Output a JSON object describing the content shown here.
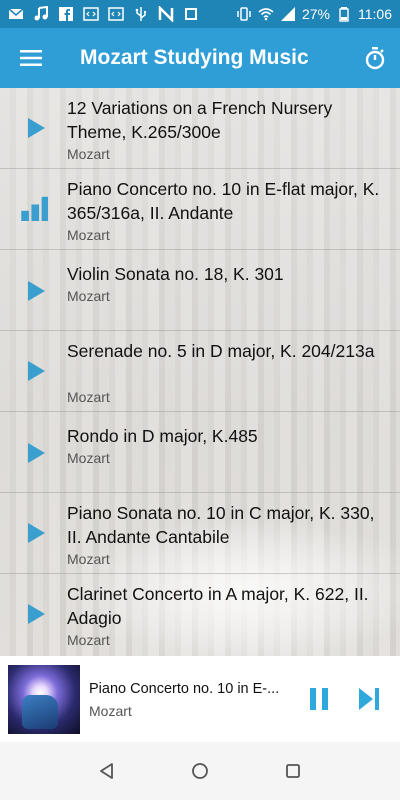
{
  "status_bar": {
    "battery": "27%",
    "time": "11:06",
    "icons": [
      "mail-icon",
      "music-note-icon",
      "facebook-icon",
      "code-icon",
      "code-icon",
      "usb-icon",
      "n-icon",
      "screenshot-icon",
      "vibrate-icon",
      "wifi-icon",
      "signal-icon",
      "battery-icon"
    ]
  },
  "app_bar": {
    "title": "Mozart Studying Music"
  },
  "tracks": [
    {
      "title": "12 Variations on a French Nursery Theme, K.265/300e",
      "artist": "Mozart",
      "state": "play"
    },
    {
      "title": "Piano Concerto no. 10 in E-flat major, K. 365/316a, II. Andante",
      "artist": "Mozart",
      "state": "playing"
    },
    {
      "title": "Violin Sonata no. 18, K. 301",
      "artist": "Mozart",
      "state": "play"
    },
    {
      "title": "Serenade no. 5 in D major, K. 204/213a",
      "artist": "Mozart",
      "state": "play"
    },
    {
      "title": "Rondo in D major, K.485",
      "artist": "Mozart",
      "state": "play"
    },
    {
      "title": "Piano Sonata no. 10 in C major, K. 330, II. Andante Cantabile",
      "artist": "Mozart",
      "state": "play"
    },
    {
      "title": "Clarinet Concerto in A major, K. 622, II. Adagio",
      "artist": "Mozart",
      "state": "play"
    }
  ],
  "now_playing": {
    "title": "Piano Concerto no. 10 in E-...",
    "artist": "Mozart"
  },
  "colors": {
    "status_bar": "#1f84b6",
    "app_bar": "#2f9ed6",
    "accent": "#2f9ed6",
    "play_icon": "#3a9fcf"
  }
}
